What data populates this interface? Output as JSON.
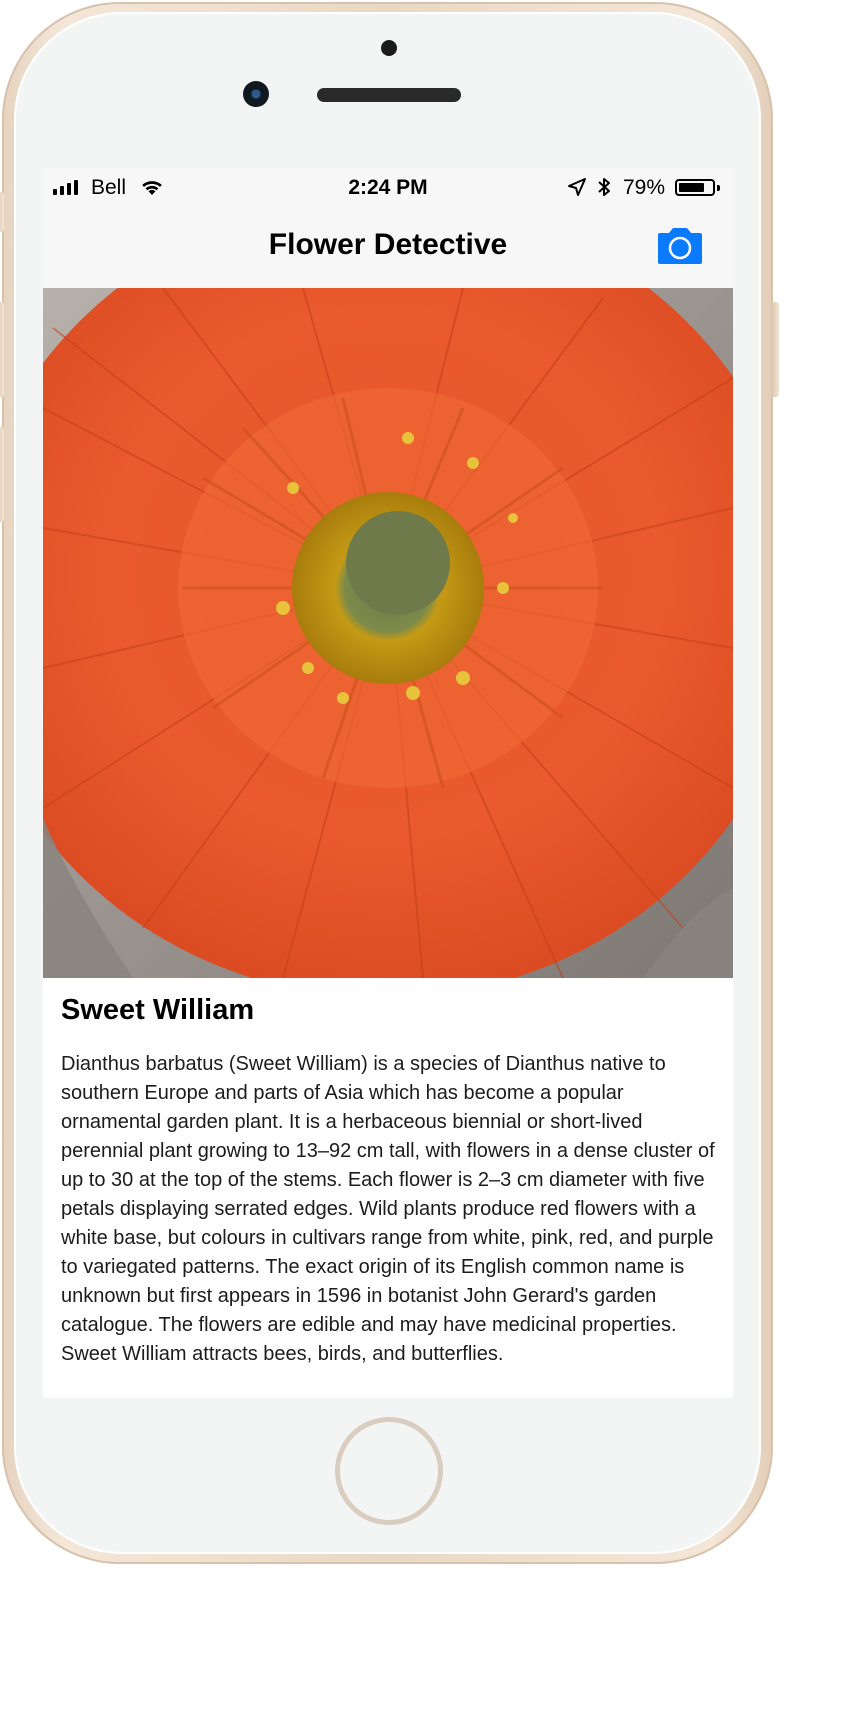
{
  "status_bar": {
    "carrier": "Bell",
    "time": "2:24 PM",
    "battery_percent": "79%",
    "battery_level": 0.79,
    "icons": [
      "signal-icon",
      "wifi-icon",
      "location-arrow-icon",
      "bluetooth-icon",
      "battery-icon"
    ]
  },
  "nav": {
    "title": "Flower Detective",
    "camera_icon": "camera-icon",
    "accent_color": "#0a7aff"
  },
  "photo": {
    "subject": "orange-red daisy-like flower with yellow-green center"
  },
  "result": {
    "name": "Sweet William",
    "description": "Dianthus barbatus (Sweet William)  is a species of Dianthus native to southern Europe and parts of Asia which has become a popular ornamental garden plant. It is a herbaceous biennial or short-lived perennial plant growing to 13–92 cm tall, with flowers in a dense cluster of up to 30 at the top of the stems. Each flower is 2–3 cm diameter with five petals displaying serrated edges. Wild plants produce red flowers with a white base, but colours in cultivars range from white, pink, red, and purple to variegated patterns. The exact origin of its English common name is unknown but first appears in 1596 in botanist John Gerard's garden catalogue. The flowers are edible and may have medicinal properties. Sweet William attracts bees, birds, and butterflies."
  }
}
